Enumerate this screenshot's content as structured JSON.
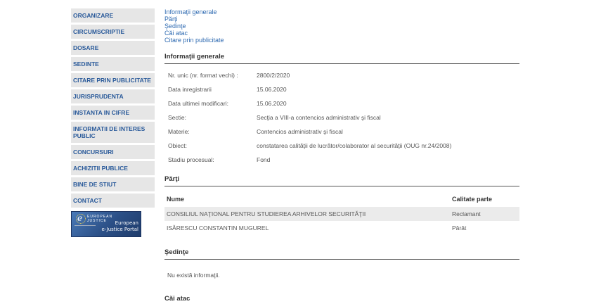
{
  "sidebar": {
    "items": [
      {
        "label": "ORGANIZARE"
      },
      {
        "label": "CIRCUMSCRIPTIE"
      },
      {
        "label": "DOSARE"
      },
      {
        "label": "SEDINTE"
      },
      {
        "label": "CITARE PRIN PUBLICITATE"
      },
      {
        "label": "JURISPRUDENTA"
      },
      {
        "label": "INSTANTA IN CIFRE"
      },
      {
        "label": "INFORMATII DE INTERES PUBLIC"
      },
      {
        "label": "CONCURSURI"
      },
      {
        "label": "ACHIZITII PUBLICE"
      },
      {
        "label": "BINE DE STIUT"
      },
      {
        "label": "CONTACT"
      }
    ],
    "banner": {
      "eu_text_1": "EUROPEAN",
      "eu_text_2": "JUSTICE",
      "portal_line1": "European",
      "portal_line2": "e-Justice Portal"
    }
  },
  "toc": {
    "links": [
      "Informaţii generale",
      "Părţi",
      "Şedinţe",
      "Căi atac",
      "Citare prin publicitate"
    ]
  },
  "info": {
    "title": "Informaţii generale",
    "rows": [
      {
        "label": "Nr. unic (nr. format vechi) :",
        "value": "2800/2/2020"
      },
      {
        "label": "Data inregistrarii",
        "value": "15.06.2020"
      },
      {
        "label": "Data ultimei modificari:",
        "value": "15.06.2020"
      },
      {
        "label": "Sectie:",
        "value": "Secţia a VIII-a contencios administrativ şi fiscal"
      },
      {
        "label": "Materie:",
        "value": "Contencios administrativ şi fiscal"
      },
      {
        "label": "Obiect:",
        "value": "constatarea calităţii de lucrător/colaborator al securităţii (OUG nr.24/2008)"
      },
      {
        "label": "Stadiu procesual:",
        "value": "Fond"
      }
    ]
  },
  "parti": {
    "title": "Părţi",
    "headers": {
      "name": "Nume",
      "role": "Calitate parte"
    },
    "rows": [
      {
        "name": "CONSILIUL NAŢIONAL PENTRU STUDIEREA ARHIVELOR SECURITĂŢII",
        "role": "Reclamant"
      },
      {
        "name": "ISĂRESCU CONSTANTIN MUGUREL",
        "role": "Pârât"
      }
    ]
  },
  "sedinte": {
    "title": "Şedinţe",
    "empty": "Nu există informaţii."
  },
  "cai_atac": {
    "title": "Căi atac"
  }
}
